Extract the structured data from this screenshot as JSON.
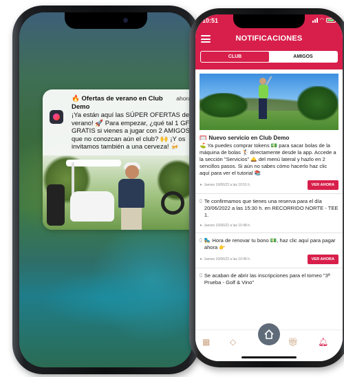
{
  "lock_notification": {
    "app_icon": "club-app-icon",
    "title_emoji": "🔥",
    "title": "Ofertas de verano en Club Demo",
    "time": "ahora",
    "body": "¡Ya están aquí las SÚPER OFERTAS de verano! 🚀 Para empezar, ¿qué tal 1 GF GRATIS si vienes a jugar con 2 AMIGOS que no conozcan aún el club? 🙌 ¡Y os invitamos también a una cerveza! 🍻"
  },
  "status_bar": {
    "time": "10:51"
  },
  "app": {
    "title": "NOTIFICACIONES",
    "menu_icon": "hamburger-icon",
    "tabs": [
      {
        "label": "CLUB",
        "active": true
      },
      {
        "label": "AMIGOS",
        "active": false
      }
    ]
  },
  "feed": [
    {
      "title_emoji": "🥅",
      "title": "Nuevo servicio en Club Demo",
      "body": "⛳ Ya puedes comprar tokens 💵 para sacar bolas de la máquina de bolas 🏌️ directamente desde la app. Accede a la sección \"Servicios\" 🛎️ del menú lateral y hazlo en 2 sencillos pasos. Si aún no sabes cómo hacerlo haz clic aquí para ver el tutorial 📚",
      "meta": "Jueves 16/06/22 a las 10:51 h.",
      "button": "VER AHORA"
    },
    {
      "body": "Te confirmamos que tienes una reserva para el día 20/06/2022 a las 15:30 h. en RECORRIDO NORTE - TEE 1.",
      "meta": "Jueves 16/06/22 a las 10:48 h."
    },
    {
      "body": "🛼 Hora de renovar tu bono 💵, haz clic aquí para pagar ahora 👉",
      "meta": "Jueves 16/06/22 a las 10:46 h.",
      "button": "VER AHORA"
    },
    {
      "body": "Se acaban de abrir las inscripciones para el torneo \"3ª Prueba - Golf & Vino\""
    }
  ],
  "bottom_nav": {
    "items": [
      "calendar-icon",
      "ticket-icon",
      "home-icon",
      "gift-icon",
      "bell-icon"
    ],
    "active": "bell-icon"
  },
  "colors": {
    "brand": "#d81f4b"
  }
}
